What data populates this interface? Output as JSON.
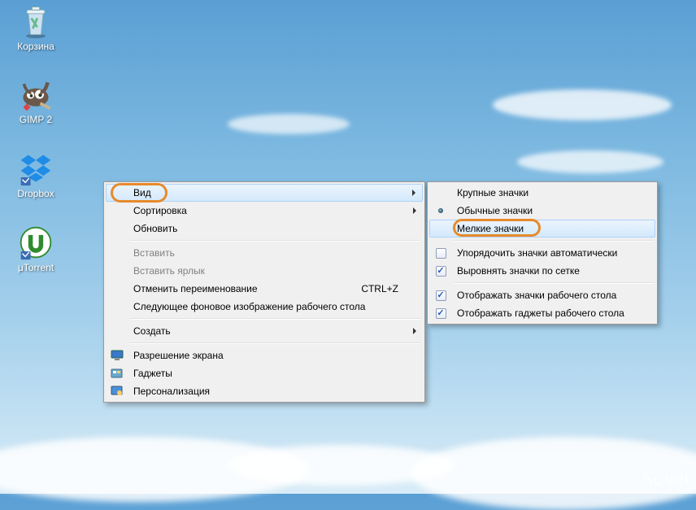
{
  "desktop_icons": [
    {
      "name": "recycle-bin",
      "label": "Корзина"
    },
    {
      "name": "gimp",
      "label": "GIMP 2"
    },
    {
      "name": "dropbox",
      "label": "Dropbox"
    },
    {
      "name": "utorrent",
      "label": "μTorrent"
    }
  ],
  "menu_main": {
    "view": "Вид",
    "sort": "Сортировка",
    "refresh": "Обновить",
    "paste": "Вставить",
    "paste_link": "Вставить ярлык",
    "undo": "Отменить переименование",
    "undo_key": "CTRL+Z",
    "next_bg": "Следующее фоновое изображение рабочего стола",
    "create": "Создать",
    "resolution": "Разрешение экрана",
    "gadgets": "Гаджеты",
    "personalize": "Персонализация"
  },
  "menu_sub": {
    "large": "Крупные значки",
    "medium": "Обычные значки",
    "small": "Мелкие значки",
    "auto_arrange": "Упорядочить значки автоматически",
    "snap_grid": "Выровнять значки по сетке",
    "show_icons": "Отображать значки рабочего стола",
    "show_gadgets": "Отображать гаджеты  рабочего стола",
    "selected": "medium"
  },
  "watermark": {
    "top": "club",
    "bottom": "Sovet"
  }
}
